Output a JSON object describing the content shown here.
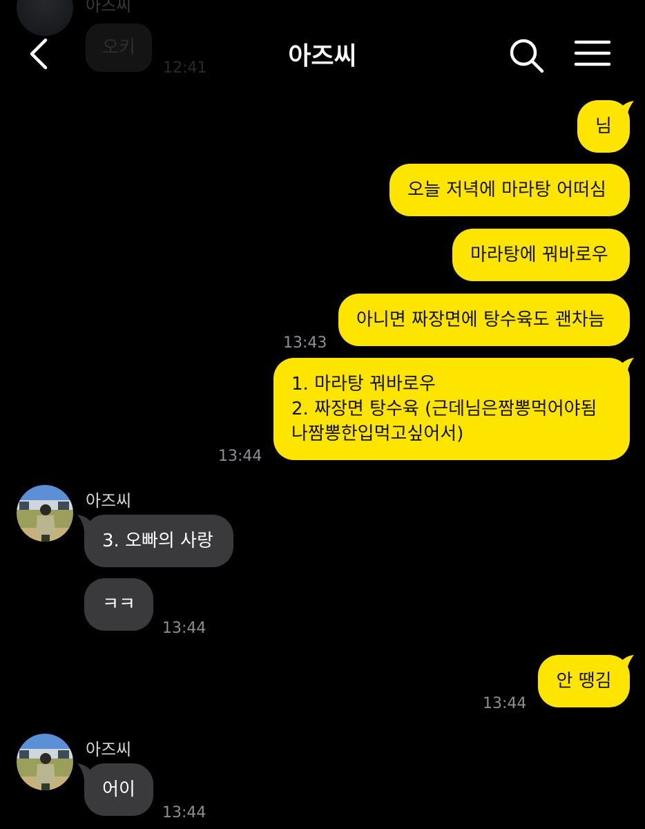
{
  "header": {
    "title": "아즈씨"
  },
  "faded_top": {
    "sender": "아즈씨",
    "message": "오키",
    "time": "12:41"
  },
  "messages_out": [
    {
      "text": "님"
    },
    {
      "text": "오늘 저녁에 마라탕 어떠심"
    },
    {
      "text": "마라탕에 꿔바로우"
    },
    {
      "text": "아니면 짜장면에 탕수육도 괜차늠",
      "time": "13:43"
    },
    {
      "lines": [
        "1. 마라탕 꿔바로우",
        "2. 짜장면 탕수육 (근데님은짬뽕먹어야됨",
        "나짬뽕한입먹고싶어서)"
      ],
      "time": "13:44"
    },
    {
      "text": "안 땡김",
      "time": "13:44"
    }
  ],
  "incoming_groups": [
    {
      "sender": "아즈씨",
      "messages": [
        {
          "text": "3. 오빠의 사랑"
        },
        {
          "text": "ㅋㅋ",
          "time": "13:44"
        }
      ]
    },
    {
      "sender": "아즈씨",
      "messages": [
        {
          "text": "어이",
          "time": "13:44"
        }
      ]
    }
  ],
  "colors": {
    "background": "#000000",
    "bubble_out": "#fee500",
    "bubble_in": "#3a3a3c",
    "time_text": "#8e8e93"
  },
  "icons": {
    "back": "chevron-left-icon",
    "search": "search-icon",
    "menu": "hamburger-menu-icon"
  }
}
